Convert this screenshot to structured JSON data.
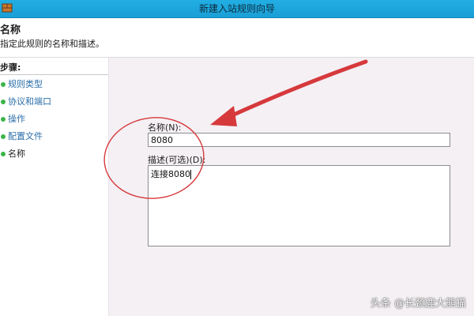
{
  "window": {
    "title": "新建入站规则向导"
  },
  "header": {
    "title": "名称",
    "description": "指定此规则的名称和描述。"
  },
  "steps": {
    "heading": "步骤:",
    "items": [
      {
        "label": "规则类型",
        "state": "done"
      },
      {
        "label": "协议和端口",
        "state": "done"
      },
      {
        "label": "操作",
        "state": "done"
      },
      {
        "label": "配置文件",
        "state": "done"
      },
      {
        "label": "名称",
        "state": "current"
      }
    ]
  },
  "form": {
    "name_label": "名称(N):",
    "name_value": "8080",
    "desc_label": "描述(可选)(D):",
    "desc_value": "连接8080"
  },
  "watermark": "头条 @长颈鹿大熊猫",
  "colors": {
    "titlebar": "#1a9fd6",
    "annotation": "#d6393c",
    "step_link": "#2b6ea8",
    "step_dot": "#3cb54a"
  }
}
